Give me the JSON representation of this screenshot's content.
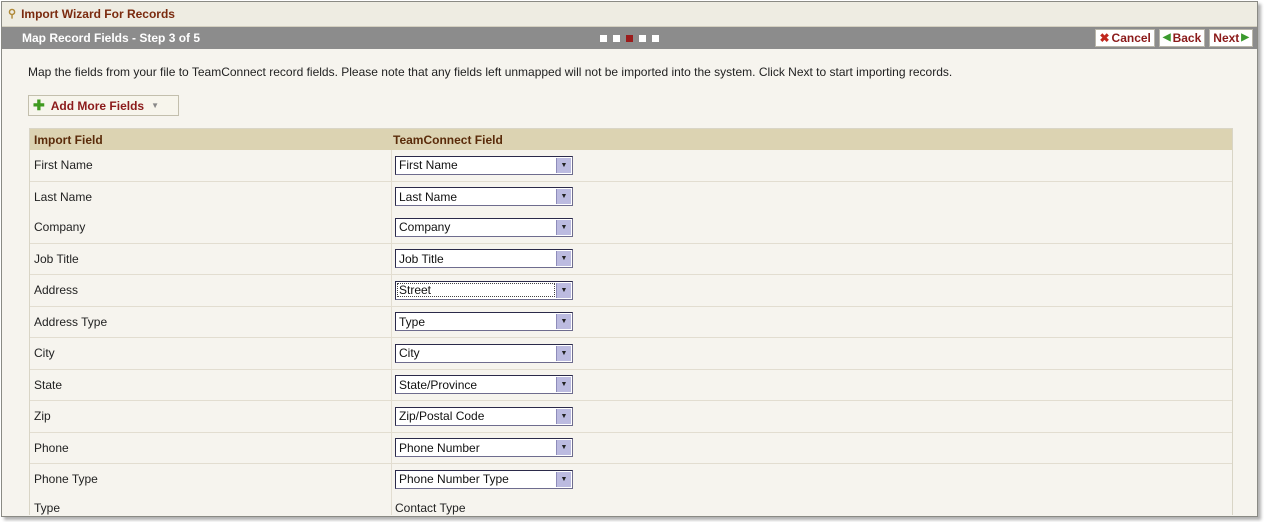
{
  "window": {
    "title": "Import Wizard For Records",
    "step_title": "Map Record Fields - Step 3 of 5",
    "steps": [
      {
        "state": "inactive"
      },
      {
        "state": "inactive"
      },
      {
        "state": "active"
      },
      {
        "state": "inactive"
      },
      {
        "state": "inactive"
      }
    ],
    "buttons": {
      "cancel": "Cancel",
      "back": "Back",
      "next": "Next"
    }
  },
  "main": {
    "intro": "Map the fields from your file to TeamConnect record fields. Please note that any fields left unmapped will not be imported into the system. Click Next to start importing records.",
    "add_more_label": "Add More Fields",
    "table": {
      "headers": {
        "import_field": "Import Field",
        "teamconnect_field": "TeamConnect Field"
      },
      "rows": [
        {
          "import": "First Name",
          "mapped": "First Name"
        },
        {
          "import": "Last Name",
          "mapped": "Last Name"
        },
        {
          "import": "Company",
          "mapped": "Company"
        },
        {
          "import": "Job Title",
          "mapped": "Job Title"
        },
        {
          "import": "Address",
          "mapped": "Street"
        },
        {
          "import": "Address Type",
          "mapped": "Type"
        },
        {
          "import": "City",
          "mapped": "City"
        },
        {
          "import": "State",
          "mapped": "State/Province"
        },
        {
          "import": "Zip",
          "mapped": "Zip/Postal Code"
        },
        {
          "import": "Phone",
          "mapped": "Phone Number"
        },
        {
          "import": "Phone Type",
          "mapped": "Phone Number Type"
        },
        {
          "import": "Type",
          "mapped": "Contact Type"
        }
      ]
    }
  },
  "colors": {
    "title_text": "#7a2a0e",
    "step_bar": "#8c8c8c",
    "active_step": "#9b1b1b",
    "header_bg": "#dcd3b2",
    "button_text": "#8b1a1a"
  }
}
